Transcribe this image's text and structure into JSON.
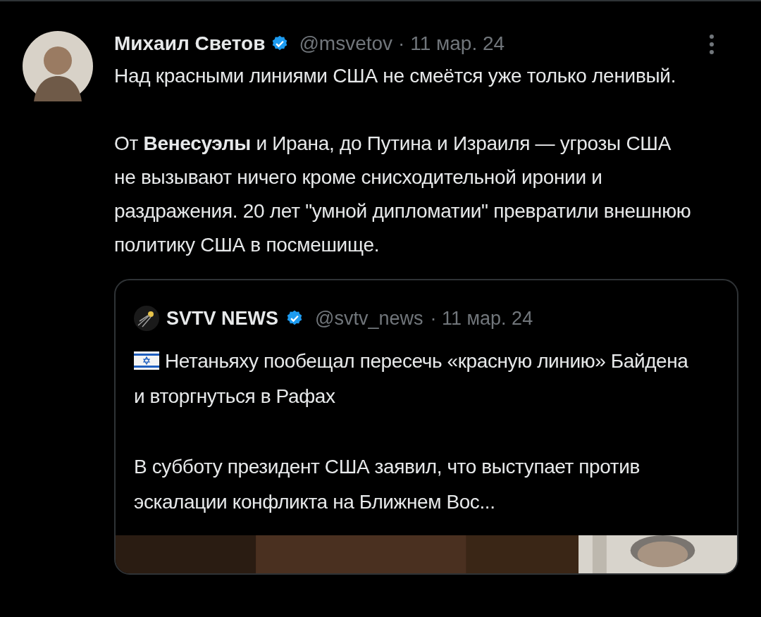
{
  "tweet": {
    "author": "Михаил Светов",
    "verified": true,
    "handle": "@msvetov",
    "date": "· 11 мар. 24",
    "paragraphs": [
      "Над красными линиями США не смеётся уже только ленивый.",
      "От **Венесуэлы** и Ирана, до Путина и Израиля — угрозы США не вызывают ничего кроме снисходительной иронии и раздражения. 20 лет \"умной дипломатии\" превратили внешнюю политику США в посмешище."
    ]
  },
  "quote": {
    "author": "SVTV NEWS",
    "verified": true,
    "handle": "@svtv_news",
    "date": "· 11 мар. 24",
    "paragraphs": [
      "Нетаньяху пообещал пересечь «красную линию» Байдена и вторгнуться в Рафах",
      "В субботу президент США заявил, что выступает против эскалации конфликта на Ближнем Вос..."
    ]
  }
}
